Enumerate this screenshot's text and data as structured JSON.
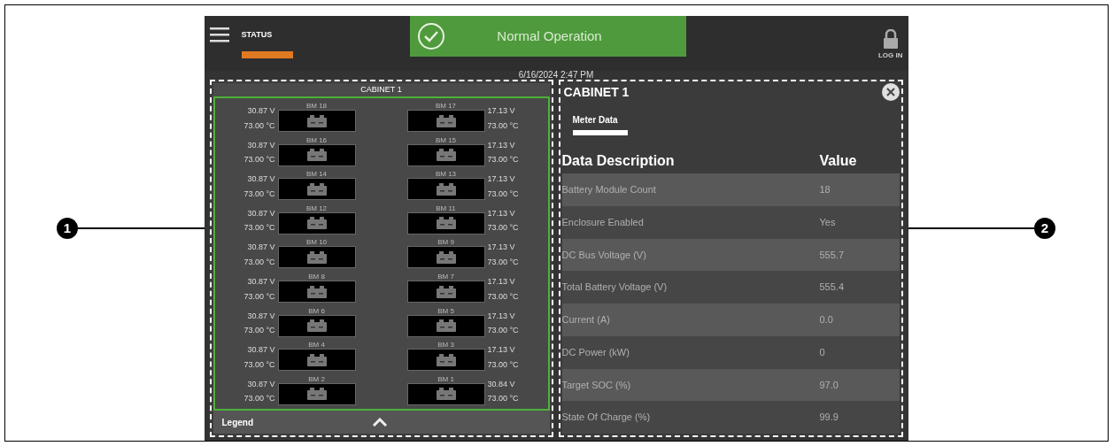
{
  "header": {
    "status_tab": {
      "label": "STATUS",
      "selected": true
    },
    "status": "Normal Operation",
    "datetime": "6/16/2024 2:47 PM",
    "login_label": "LOG IN"
  },
  "cabinet_view": {
    "title": "CABINET 1",
    "module_rows": [
      [
        {
          "name": "BM 18",
          "voltage": "30.87 V",
          "temperature": "73.00 °C"
        },
        {
          "name": "BM 17",
          "voltage": "17.13 V",
          "temperature": "73.00 °C"
        }
      ],
      [
        {
          "name": "BM 16",
          "voltage": "30.87 V",
          "temperature": "73.00 °C"
        },
        {
          "name": "BM 15",
          "voltage": "17.13 V",
          "temperature": "73.00 °C"
        }
      ],
      [
        {
          "name": "BM 14",
          "voltage": "30.87 V",
          "temperature": "73.00 °C"
        },
        {
          "name": "BM 13",
          "voltage": "17.13 V",
          "temperature": "73.00 °C"
        }
      ],
      [
        {
          "name": "BM 12",
          "voltage": "30.87 V",
          "temperature": "73.00 °C"
        },
        {
          "name": "BM 11",
          "voltage": "17.13 V",
          "temperature": "73.00 °C"
        }
      ],
      [
        {
          "name": "BM 10",
          "voltage": "30.87 V",
          "temperature": "73.00 °C"
        },
        {
          "name": "BM 9",
          "voltage": "17.13 V",
          "temperature": "73.00 °C"
        }
      ],
      [
        {
          "name": "BM 8",
          "voltage": "30.87 V",
          "temperature": "73.00 °C"
        },
        {
          "name": "BM 7",
          "voltage": "17.13 V",
          "temperature": "73.00 °C"
        }
      ],
      [
        {
          "name": "BM 6",
          "voltage": "30.87 V",
          "temperature": "73.00 °C"
        },
        {
          "name": "BM 5",
          "voltage": "17.13 V",
          "temperature": "73.00 °C"
        }
      ],
      [
        {
          "name": "BM 4",
          "voltage": "30.87 V",
          "temperature": "73.00 °C"
        },
        {
          "name": "BM 3",
          "voltage": "17.13 V",
          "temperature": "73.00 °C"
        }
      ],
      [
        {
          "name": "BM 2",
          "voltage": "30.87 V",
          "temperature": "73.00 °C"
        },
        {
          "name": "BM 1",
          "voltage": "30.84 V",
          "temperature": "73.00 °C"
        }
      ]
    ],
    "legend": "Legend"
  },
  "detail": {
    "title": "CABINET 1",
    "tabs": [
      {
        "label": "Meter Data",
        "selected": true
      }
    ],
    "columns": [
      "Data Description",
      "Value"
    ],
    "rows": [
      [
        "Battery Module Count",
        "18"
      ],
      [
        "Enclosure Enabled",
        "Yes"
      ],
      [
        "DC Bus Voltage (V)",
        "555.7"
      ],
      [
        "Total Battery Voltage (V)",
        "555.4"
      ],
      [
        "Current (A)",
        "0.0"
      ],
      [
        "DC Power (kW)",
        "0"
      ],
      [
        "Target SOC (%)",
        "97.0"
      ],
      [
        "State Of Charge (%)",
        "99.9"
      ]
    ]
  },
  "callouts": [
    "1",
    "2"
  ]
}
